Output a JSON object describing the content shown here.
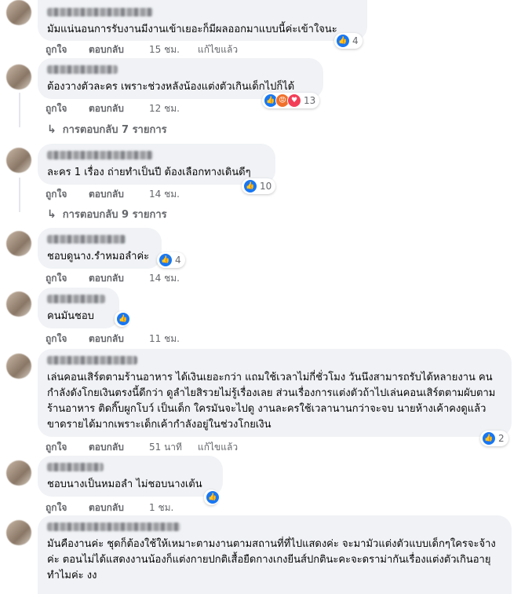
{
  "labels": {
    "like": "ถูกใจ",
    "reply": "ตอบกลับ",
    "edited": "แก้ไขแล้ว"
  },
  "colors": {
    "bubble": "#f0f2f5",
    "like_blue": "#1877f2",
    "meta_grey": "#65676b"
  },
  "comments": [
    {
      "text": "มัมแน่นอนการรับงานมีงานเข้าเยอะก็มีผลออกมาแบบนี้ค่ะเข้าใจนะ",
      "time": "15 ชม.",
      "edited": true,
      "reactions": [
        "like-icon"
      ],
      "reaction_count": "4"
    },
    {
      "text": "ต้องวางตัวละคร เพราะช่วงหลังน้องแต่งตัวเกินเด็กไปก็ได้",
      "time": "12 ชม.",
      "edited": false,
      "reactions": [
        "like-icon",
        "angry-icon",
        "love-icon"
      ],
      "reaction_count": "13",
      "replies": "การตอบกลับ 7 รายการ"
    },
    {
      "text": "ละคร 1 เรื่อง ถ่ายทำเป็นปี ต้องเลือกทางเดินดีๆ",
      "time": "14 ชม.",
      "edited": false,
      "reactions": [
        "like-icon"
      ],
      "reaction_count": "10",
      "replies": "การตอบกลับ 9 รายการ"
    },
    {
      "name_text": "แ...... ........",
      "text": "ชอบดูนาง.รำหมอลำค่ะ",
      "time": "14 ชม.",
      "edited": false,
      "reactions": [
        "like-icon"
      ],
      "reaction_count": "4"
    },
    {
      "text": "คนมันชอบ",
      "time": "11 ชม.",
      "edited": false,
      "reactions": [
        "like-icon"
      ],
      "reaction_count": ""
    },
    {
      "text": "เล่นคอนเสิร์ตตามร้านอาหาร ได้เงินเยอะกว่า แถมใช้เวลาไม่กี่ชั่วโมง วันนึงสามารถรับได้หลายงาน คนกำลังดังโกยเงินตรงนี้ดีกว่า ดูลำไยสิรวยไม่รู้เรื่องเลย ส่วนเรื่องการแต่งตัวถ้าไปเล่นคอนเสิร์ตตามผับตามร้านอาหาร ติดกิ๊บผูกโบว์ เป็นเด็ก ใครมันจะไปดู งานละครใช้เวลานานกว่าจะจบ นายห้างเค้าคงดูแล้ว ขาดรายได้มากเพราะเด็กเค้ากำลังอยู่ในช่วงโกยเงิน",
      "time": "51 นาที",
      "edited": true,
      "reactions": [
        "like-icon"
      ],
      "reaction_count": "2"
    },
    {
      "text": "ชอบนางเป็นหมอลำ ไม่ชอบนางเต้น",
      "time": "1 ชม.",
      "edited": false,
      "reactions": [
        "like-icon"
      ],
      "reaction_count": ""
    },
    {
      "text": "มันคืองานค่ะ ชุดก็ต้องใช้ให้เหมาะตามงานตามสถานที่ที่ไปแสดงค่ะ จะมามัวแต่งตัวแบบเด็กๆใครจะจ้างค่ะ ตอนไม่ได้แสดงงานน้องก็แต่งกายปกติเสื้อยืดกางเกงยีนส์ปกตินะคะจะดราม่ากันเรื่องแต่งตัวเกินอายุทำไมค่ะ งง",
      "reactions": [],
      "reaction_count": ""
    }
  ]
}
